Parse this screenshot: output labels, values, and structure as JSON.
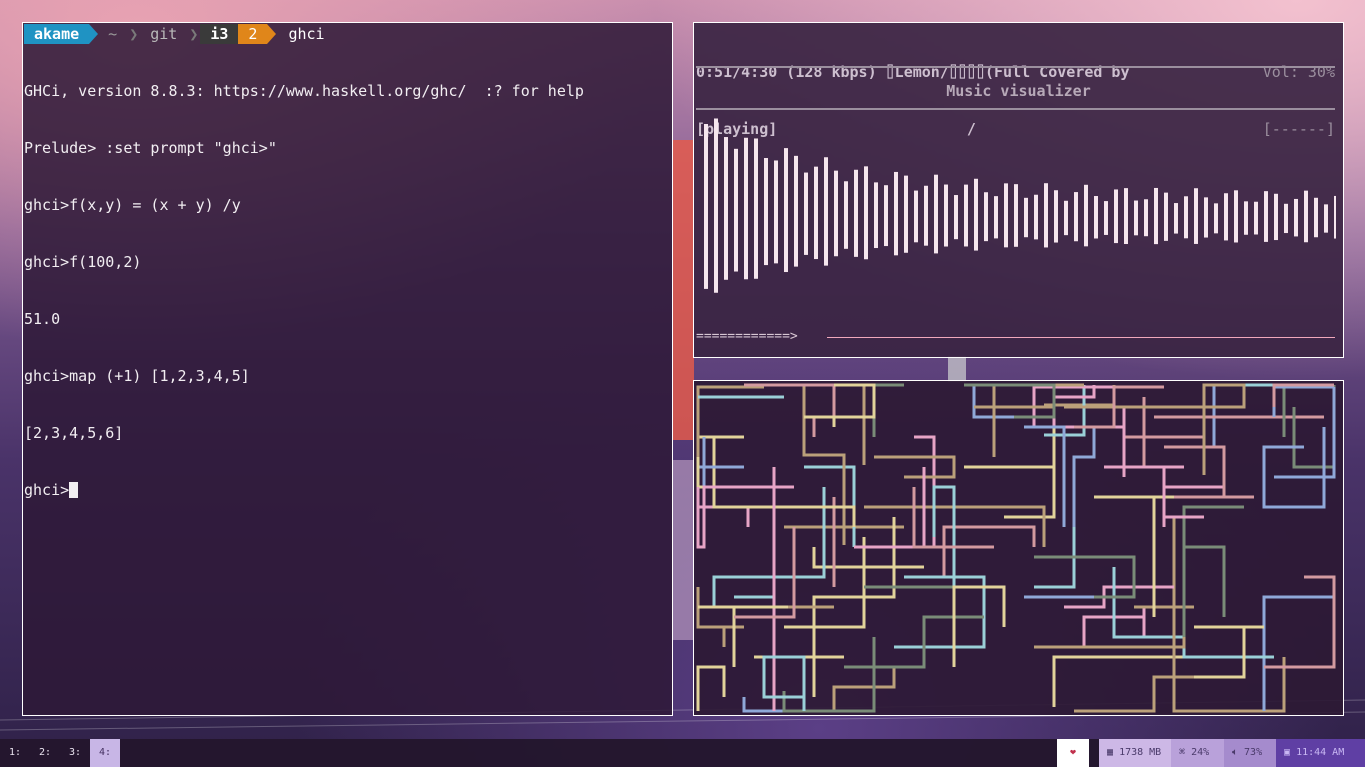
{
  "terminal": {
    "prompt": {
      "user": "akame",
      "home": "~",
      "dir1": "git",
      "dir2": "i3",
      "jobs": "2",
      "command": "ghci"
    },
    "lines": [
      "GHCi, version 8.8.3: https://www.haskell.org/ghc/  :? for help",
      "Prelude> :set prompt \"ghci>\"",
      "ghci>f(x,y) = (x + y) /y",
      "ghci>f(100,2)",
      "51.0",
      "ghci>map (+1) [1,2,3,4,5]",
      "[2,3,4,5,6]",
      "ghci>"
    ]
  },
  "music": {
    "status_line1": "0:51/4:30 (128 kbps) ⌷Lemon/⌷⌷⌷⌷(Full Covered by",
    "status_line2": "[playing]                     /",
    "volume": "Vol: 30%",
    "volume_bar": "[------]",
    "title": "Music visualizer",
    "progress": "============>",
    "visualizer_colour": "#f6e6ee",
    "progress_colour": "#f0a8bc"
  },
  "pipes": {
    "colours": [
      "#e2d39a",
      "#e7a4c6",
      "#9ad0d8",
      "#8fa8d8",
      "#7a8c78",
      "#d39aa0",
      "#bba07a"
    ]
  },
  "bar": {
    "workspaces": [
      "1:",
      "2:",
      "3:",
      "4:"
    ],
    "active_workspace": "4:",
    "heart_icon": "heart-icon",
    "memory": "1738 MB",
    "cpu": "24%",
    "volume": "73%",
    "time": "11:44 AM"
  }
}
